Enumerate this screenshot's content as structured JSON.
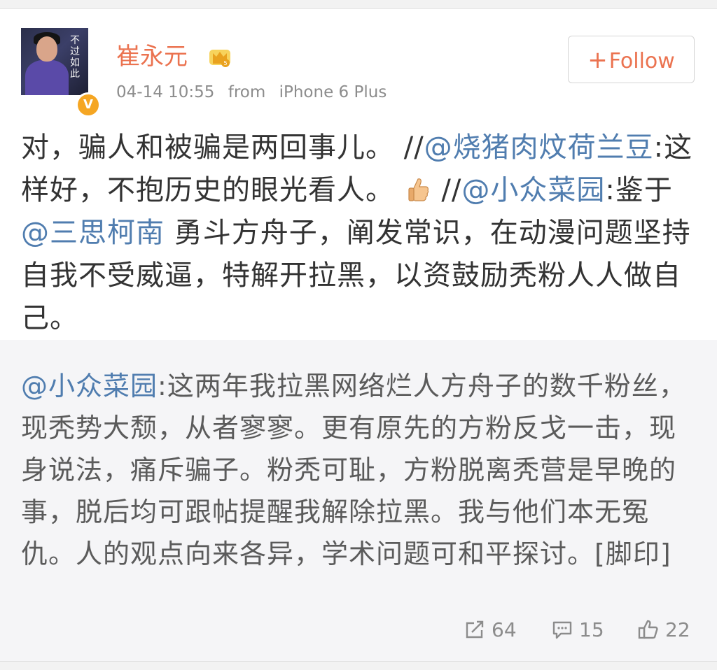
{
  "post": {
    "author": "崔永元",
    "avatar_caption": "不过如此",
    "verified_mark": "V",
    "timestamp": "04-14 10:55",
    "source": "from",
    "device": "iPhone 6 Plus",
    "follow_label": "Follow",
    "follow_prefix": "+",
    "text": {
      "p1": "对，骗人和被骗是两回事儿。 //",
      "m1": "@烧猪肉炆荷兰豆",
      "p2": ":这样好，不抱历史的眼光看人。",
      "p3": " //",
      "m2": "@小众菜园",
      "p4": ":鉴于",
      "m3": "@三思柯南",
      "p5": " 勇斗方舟子，阐发常识，在动漫问题坚持自我不受威逼，特解开拉黑，以资鼓励秃粉人人做自己。"
    }
  },
  "retweet": {
    "mention": "@小众菜园",
    "text": ":这两年我拉黑网络烂人方舟子的数千粉丝，现秃势大颓，从者寥寥。更有原先的方粉反戈一击，现身说法，痛斥骗子。粉秃可耻，方粉脱离秃营是早晚的事，脱后均可跟帖提醒我解除拉黑。我与他们本无冤仇。人的观点向来各异，学术问题可和平探讨。[脚印]",
    "repost_count": "64",
    "comment_count": "15",
    "like_count": "22"
  },
  "colors": {
    "accent": "#eb7350",
    "mention": "#507daf",
    "verified": "#f5a623"
  },
  "icons": [
    "crown-icon",
    "verified-icon",
    "thumbs-up-icon",
    "repost-icon",
    "comment-icon",
    "like-icon"
  ]
}
